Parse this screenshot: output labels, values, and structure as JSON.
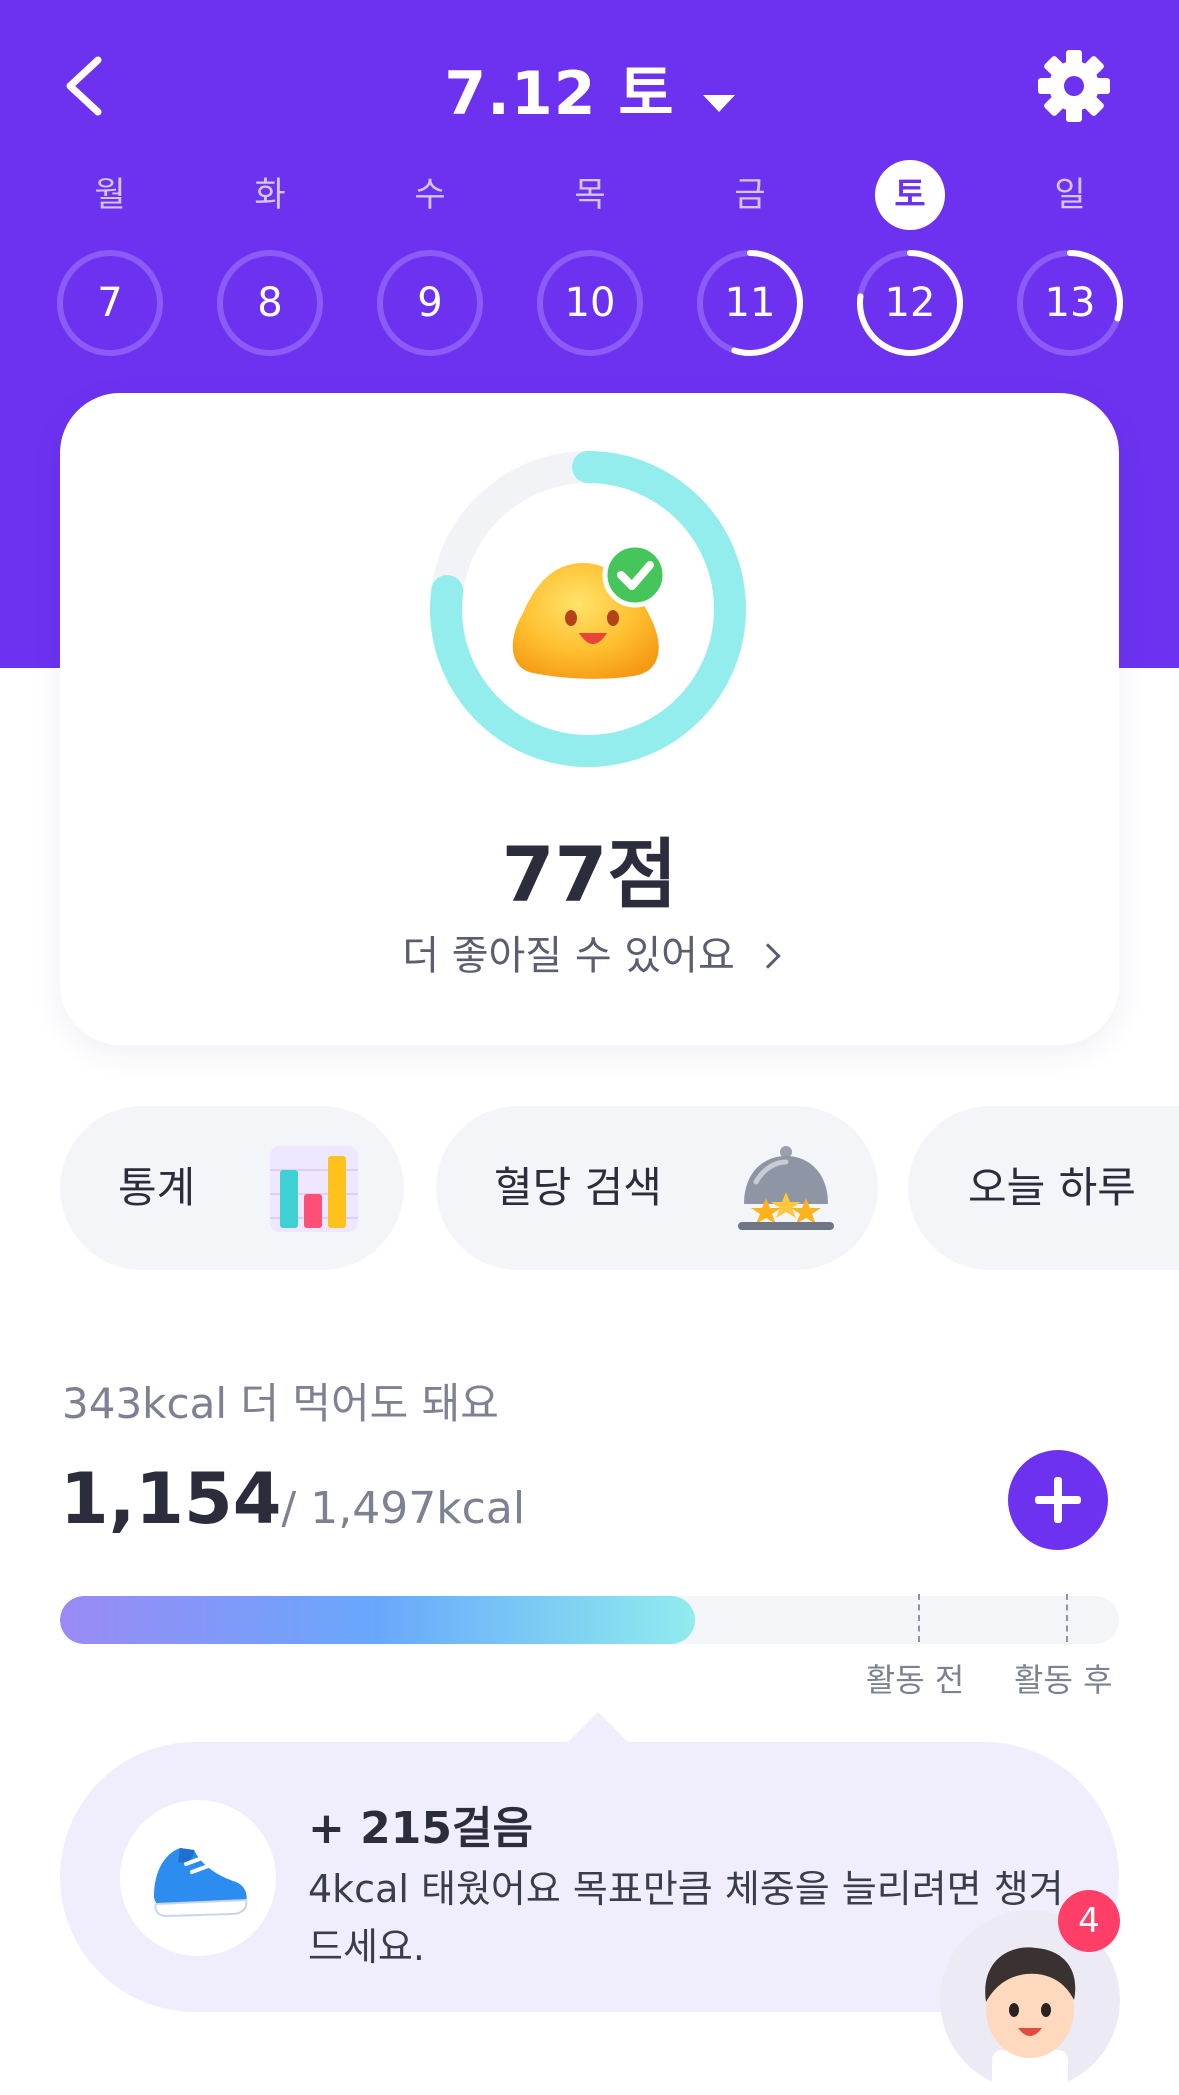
{
  "header": {
    "title": "7.12 토",
    "colors": {
      "background": "#6c32f0",
      "selected_text": "#6c32f0"
    },
    "icons": {
      "back": "chevron-left-icon",
      "dropdown": "caret-down-icon",
      "settings": "gear-icon"
    }
  },
  "week": {
    "days": [
      {
        "name": "월",
        "number": "7",
        "progress": 0,
        "selected": false
      },
      {
        "name": "화",
        "number": "8",
        "progress": 0,
        "selected": false
      },
      {
        "name": "수",
        "number": "9",
        "progress": 0,
        "selected": false
      },
      {
        "name": "목",
        "number": "10",
        "progress": 0,
        "selected": false
      },
      {
        "name": "금",
        "number": "11",
        "progress": 0.55,
        "selected": false
      },
      {
        "name": "토",
        "number": "12",
        "progress": 0.77,
        "selected": true
      },
      {
        "name": "일",
        "number": "13",
        "progress": 0.3,
        "selected": false
      }
    ]
  },
  "score": {
    "value_label": "77점",
    "progress": 0.77,
    "message": "더 좋아질 수 있어요",
    "ring_color": "#93eded",
    "icon": "smiling-blob-check-icon"
  },
  "shortcuts": [
    {
      "label": "통계",
      "icon": "bar-chart-icon"
    },
    {
      "label": "혈당 검색",
      "icon": "food-cloche-icon"
    },
    {
      "label": "오늘 하루",
      "icon": ""
    }
  ],
  "calories": {
    "remaining_text": "343kcal 더 먹어도 돼요",
    "consumed": "1,154",
    "target_text": "/ 1,497kcal",
    "progress": 0.6,
    "markers": [
      {
        "label": "활동 전",
        "position": 0.81
      },
      {
        "label": "활동 후",
        "position": 0.95
      }
    ],
    "add_icon": "plus-icon"
  },
  "steps": {
    "title": "+ 215걸음",
    "description": "4kcal 태웠어요 목표만큼 체중을 늘리려면 챙겨드세요.",
    "icon": "sneaker-icon"
  },
  "assistant": {
    "badge_count": "4",
    "icon": "doctor-avatar-icon",
    "badge_color": "#ff3f67"
  }
}
